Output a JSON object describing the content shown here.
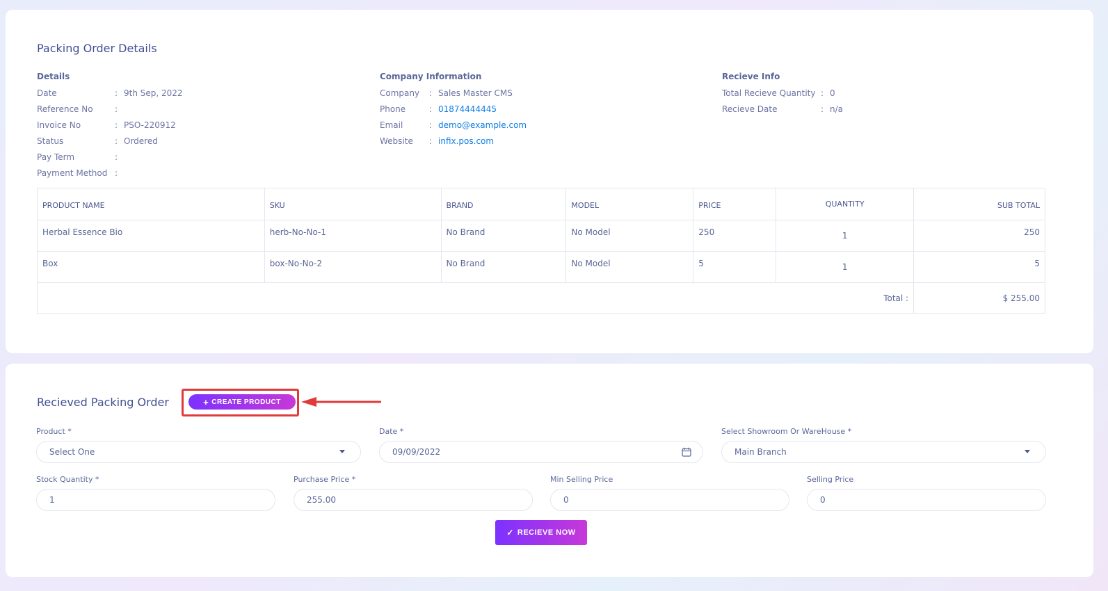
{
  "details_card": {
    "title": "Packing Order Details",
    "details": {
      "heading": "Details",
      "rows": [
        {
          "label": "Date",
          "value": "9th Sep, 2022"
        },
        {
          "label": "Reference No",
          "value": ""
        },
        {
          "label": "Invoice No",
          "value": "PSO-220912"
        },
        {
          "label": "Status",
          "value": "Ordered"
        },
        {
          "label": "Pay Term",
          "value": ""
        },
        {
          "label": "Payment Method",
          "value": ""
        }
      ]
    },
    "company": {
      "heading": "Company Information",
      "rows": [
        {
          "label": "Company",
          "value": "Sales Master CMS"
        },
        {
          "label": "Phone",
          "value": "01874444445"
        },
        {
          "label": "Email",
          "value": "demo@example.com"
        },
        {
          "label": "Website",
          "value": "infix.pos.com"
        }
      ]
    },
    "receive_info": {
      "heading": "Recieve Info",
      "rows": [
        {
          "label": "Total Recieve Quantity",
          "value": "0"
        },
        {
          "label": "Recieve Date",
          "value": "n/a"
        }
      ]
    },
    "colon": ":",
    "table": {
      "headers": [
        "PRODUCT NAME",
        "SKU",
        "BRAND",
        "MODEL",
        "PRICE",
        "QUANTITY",
        "SUB TOTAL"
      ],
      "rows": [
        {
          "name": "Herbal Essence Bio",
          "sku": "herb-No-No-1",
          "brand": "No Brand",
          "model": "No Model",
          "price": "250",
          "quantity": "1",
          "subtotal": "250"
        },
        {
          "name": "Box",
          "sku": "box-No-No-2",
          "brand": "No Brand",
          "model": "No Model",
          "price": "5",
          "quantity": "1",
          "subtotal": "5"
        }
      ],
      "total_label": "Total :",
      "total_value": "$ 255.00"
    }
  },
  "receive_card": {
    "title": "Recieved Packing Order",
    "create_button": "CREATE PRODUCT",
    "fields": {
      "product": {
        "label": "Product *",
        "value": "Select One"
      },
      "date": {
        "label": "Date *",
        "value": "09/09/2022"
      },
      "showroom": {
        "label": "Select Showroom Or WareHouse *",
        "value": "Main Branch"
      },
      "stock_qty": {
        "label": "Stock Quantity *",
        "value": "1"
      },
      "purchase_price": {
        "label": "Purchase Price *",
        "value": "255.00"
      },
      "min_selling_price": {
        "label": "Min Selling Price",
        "value": "0"
      },
      "selling_price": {
        "label": "Selling Price",
        "value": "0"
      }
    },
    "receive_button": "RECIEVE NOW"
  },
  "colors": {
    "accent_start": "#7c32ff",
    "accent_end": "#c738d8",
    "link": "#0d7ee6",
    "highlight": "#e03a3a"
  }
}
